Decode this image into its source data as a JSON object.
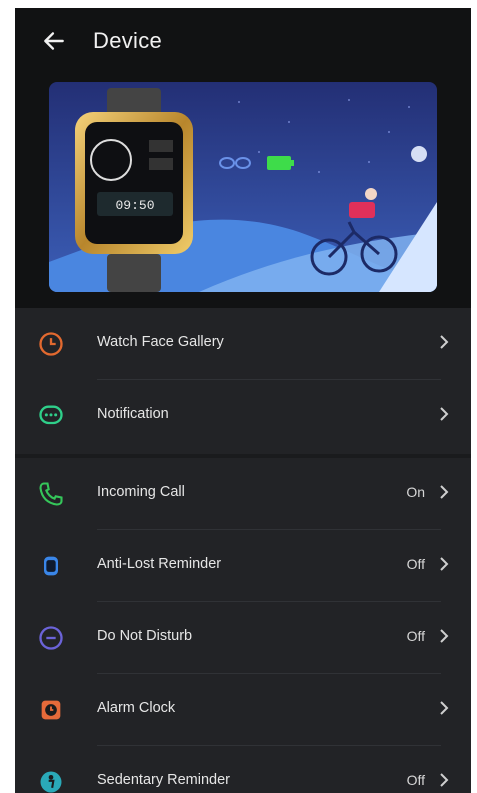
{
  "header": {
    "title": "Device",
    "back_icon": "arrow-left-icon"
  },
  "banner": {
    "watch_time": "09:50",
    "image": "smartwatch-promo"
  },
  "group1": [
    {
      "label": "Watch Face Gallery",
      "value": "",
      "icon": "watch-face-icon",
      "color": "#e2692f"
    },
    {
      "label": "Notification",
      "value": "",
      "icon": "message-icon",
      "color": "#2fcf8a"
    }
  ],
  "group2": [
    {
      "label": "Incoming Call",
      "value": "On",
      "icon": "phone-icon",
      "color": "#35c65a"
    },
    {
      "label": "Anti-Lost Reminder",
      "value": "Off",
      "icon": "watch-icon",
      "color": "#3a86e8"
    },
    {
      "label": "Do Not Disturb",
      "value": "Off",
      "icon": "do-not-disturb-icon",
      "color": "#6b63d8"
    },
    {
      "label": "Alarm Clock",
      "value": "",
      "icon": "alarm-clock-icon",
      "color": "#e66a3a"
    },
    {
      "label": "Sedentary Reminder",
      "value": "Off",
      "icon": "sedentary-icon",
      "color": "#2aa9b8"
    }
  ]
}
